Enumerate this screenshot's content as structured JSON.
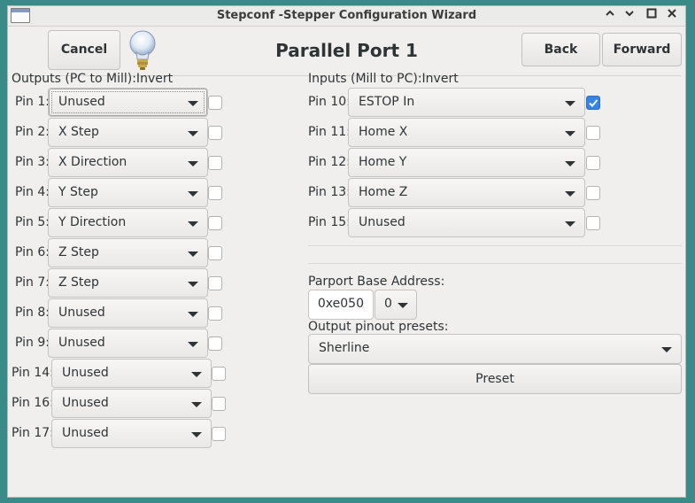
{
  "window": {
    "title": "Stepconf -Stepper Configuration Wizard",
    "controls": {
      "minimize": "︿",
      "shade": "﹀",
      "maximize": "☐",
      "close": "✕"
    }
  },
  "header": {
    "cancel_label": "Cancel",
    "page_title": "Parallel Port 1",
    "back_label": "Back",
    "forward_label": "Forward",
    "hint_icon": "lightbulb-icon"
  },
  "outputs": {
    "heading": "Outputs (PC to Mill):Invert",
    "pins": [
      {
        "label": "Pin 1:",
        "value": "Unused",
        "invert": false
      },
      {
        "label": "Pin 2:",
        "value": "X Step",
        "invert": false
      },
      {
        "label": "Pin 3:",
        "value": "X Direction",
        "invert": false
      },
      {
        "label": "Pin 4:",
        "value": "Y Step",
        "invert": false
      },
      {
        "label": "Pin 5:",
        "value": "Y Direction",
        "invert": false
      },
      {
        "label": "Pin 6:",
        "value": "Z Step",
        "invert": false
      },
      {
        "label": "Pin 7:",
        "value": "Z Step",
        "invert": false
      },
      {
        "label": "Pin 8:",
        "value": "Unused",
        "invert": false
      },
      {
        "label": "Pin 9:",
        "value": "Unused",
        "invert": false
      },
      {
        "label": "Pin 14:",
        "value": "Unused",
        "invert": false
      },
      {
        "label": "Pin 16:",
        "value": "Unused",
        "invert": false
      },
      {
        "label": "Pin 17:",
        "value": "Unused",
        "invert": false
      }
    ]
  },
  "inputs": {
    "heading": "Inputs (Mill to PC):Invert",
    "pins": [
      {
        "label": "Pin 10:",
        "value": "ESTOP In",
        "invert": true
      },
      {
        "label": "Pin 11:",
        "value": "Home X",
        "invert": false
      },
      {
        "label": "Pin 12:",
        "value": "Home Y",
        "invert": false
      },
      {
        "label": "Pin 13:",
        "value": "Home Z",
        "invert": false
      },
      {
        "label": "Pin 15:",
        "value": "Unused",
        "invert": false
      }
    ]
  },
  "parport": {
    "base_address_label": "Parport Base Address:",
    "base_address_value": "0xe050",
    "index_value": "0",
    "presets_label": "Output pinout presets:",
    "preset_value": "Sherline",
    "preset_button_label": "Preset"
  },
  "colors": {
    "accent": "#3584e4",
    "desktop": "#3a8a8a"
  }
}
